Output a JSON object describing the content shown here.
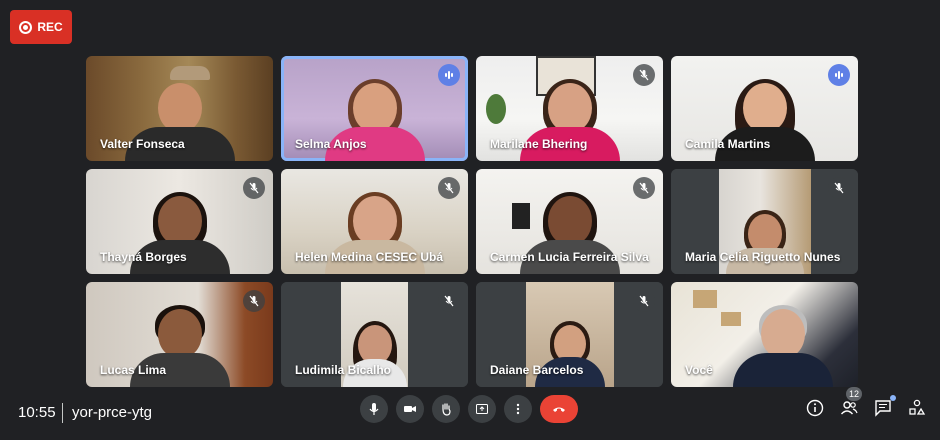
{
  "recording": {
    "label": "REC",
    "color": "#d93025"
  },
  "meeting": {
    "time": "10:55",
    "code": "yor-prce-ytg"
  },
  "participants": [
    {
      "name": "Valter Fonseca",
      "status": "none"
    },
    {
      "name": "Selma Anjos",
      "status": "speaking"
    },
    {
      "name": "Marilane Bhering",
      "status": "muted"
    },
    {
      "name": "Camila Martins",
      "status": "speaking"
    },
    {
      "name": "Thayná Borges",
      "status": "muted"
    },
    {
      "name": "Helen Medina CESEC Ubá",
      "status": "muted"
    },
    {
      "name": "Carmen Lucia Ferreira Silva",
      "status": "muted"
    },
    {
      "name": "Maria Celia Riguetto Nunes",
      "status": "muted"
    },
    {
      "name": "Lucas Lima",
      "status": "muted"
    },
    {
      "name": "Ludimila Bicalho",
      "status": "muted"
    },
    {
      "name": "Daiane Barcelos",
      "status": "none"
    },
    {
      "name": "Você",
      "status": "none"
    }
  ],
  "controls": [
    "mic-icon",
    "camera-icon",
    "raise-hand-icon",
    "present-icon",
    "more-icon",
    "end-call-icon"
  ],
  "side_panel": {
    "people_count": "12",
    "icons": [
      "info-icon",
      "people-icon",
      "chat-icon",
      "activities-icon"
    ]
  },
  "colors": {
    "background": "#202124",
    "speaking": "#5f80e6",
    "end_call": "#ea4335",
    "active_border": "#8ab4f8"
  }
}
